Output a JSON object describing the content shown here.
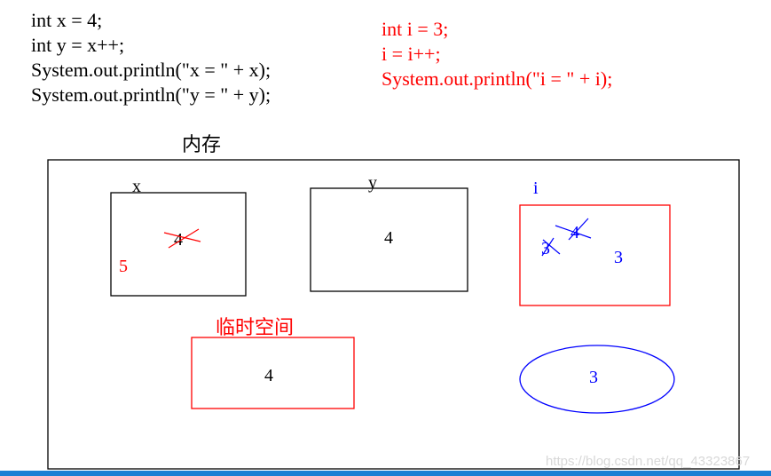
{
  "code_left": [
    "int x = 4;",
    "int y = x++;",
    "System.out.println(\"x = \" + x);",
    "System.out.println(\"y = \" + y);"
  ],
  "code_right": [
    "int i = 3;",
    "i = i++;",
    "System.out.println(\"i = \" + i);"
  ],
  "memory_label": "内存",
  "cells": {
    "x": {
      "label": "x",
      "value": "4",
      "new_value": "5"
    },
    "y": {
      "label": "y",
      "value": "4"
    },
    "i": {
      "label": "i",
      "struck_values": [
        "3",
        "4"
      ],
      "value": "3"
    }
  },
  "temp_space": {
    "label": "临时空间",
    "value": "4"
  },
  "ellipse_value": "3",
  "watermark": "https://blog.csdn.net/qq_43323867",
  "colors": {
    "red": "#ff0000",
    "blue": "#0000ff",
    "black": "#000000",
    "bottom_bar": "#1a7fd4"
  }
}
